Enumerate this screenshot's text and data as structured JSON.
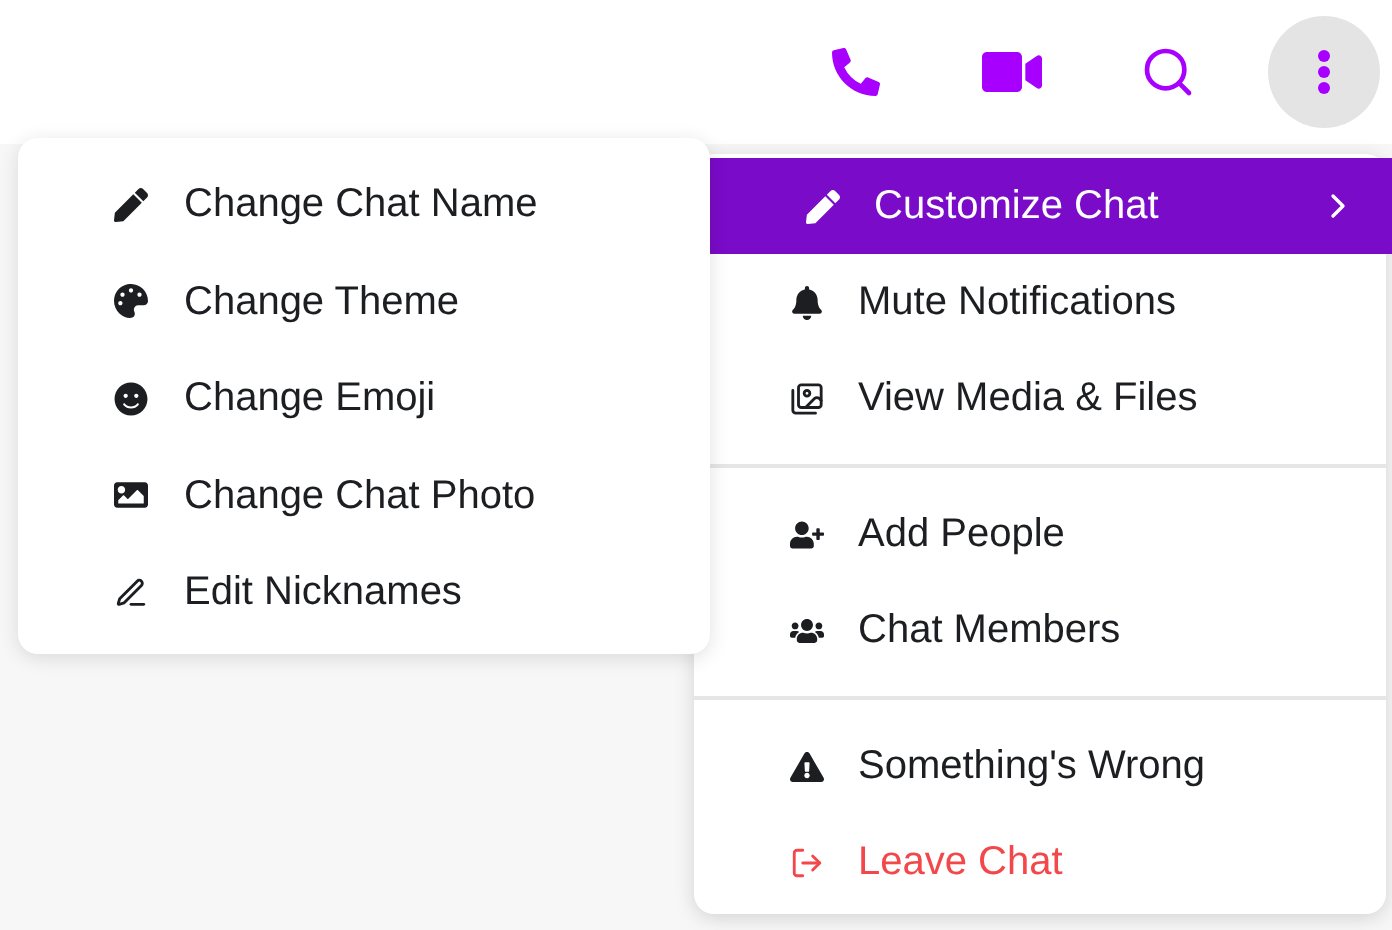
{
  "header_buttons": [
    {
      "active": false
    },
    {
      "active": false
    },
    {
      "active": false
    },
    {
      "active": true
    }
  ],
  "menu": {
    "groups": [
      [
        {
          "label": "Customize Chat",
          "selected": true,
          "has_submenu": true
        },
        {
          "label": "Mute Notifications",
          "selected": false,
          "has_submenu": false,
          "kind": "normal"
        },
        {
          "label": "View Media & Files",
          "selected": false,
          "has_submenu": false,
          "kind": "normal"
        }
      ],
      [
        {
          "label": "Add People",
          "selected": false,
          "has_submenu": false,
          "kind": "normal"
        },
        {
          "label": "Chat Members",
          "selected": false,
          "has_submenu": false,
          "kind": "normal"
        }
      ],
      [
        {
          "label": "Something's Wrong",
          "selected": false,
          "has_submenu": false,
          "kind": "normal"
        },
        {
          "label": "Leave Chat",
          "selected": false,
          "has_submenu": false,
          "kind": "danger"
        }
      ]
    ]
  },
  "submenu": {
    "items": [
      {
        "label": "Change Chat Name"
      },
      {
        "label": "Change Theme"
      },
      {
        "label": "Change Emoji"
      },
      {
        "label": "Change Chat Photo"
      },
      {
        "label": "Edit Nicknames"
      }
    ]
  }
}
